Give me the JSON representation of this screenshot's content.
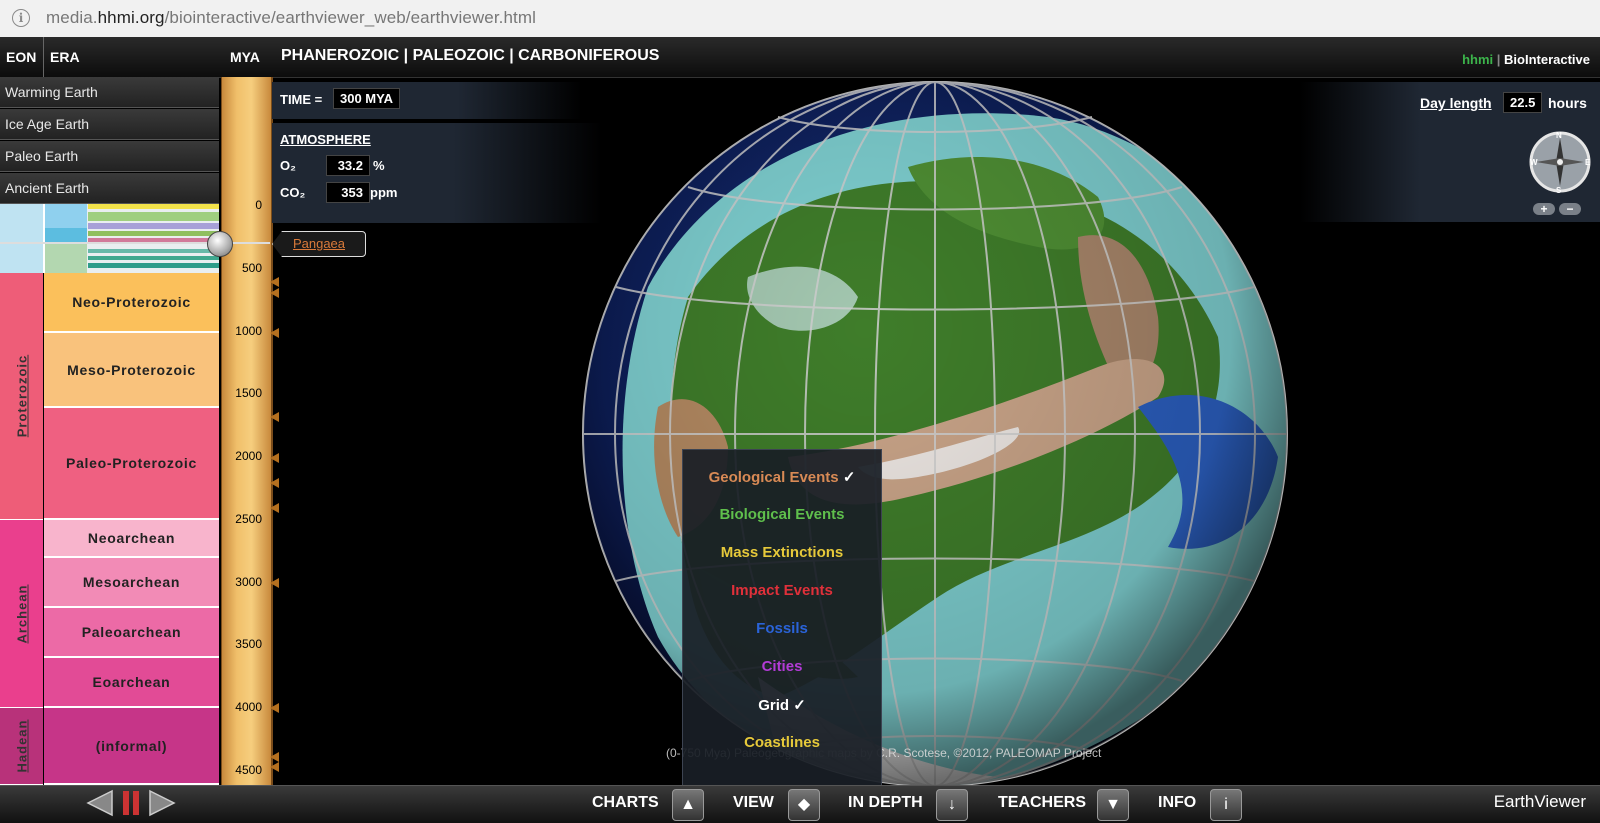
{
  "browser": {
    "url_host_prefix": "media.",
    "url_host": "hhmi.org",
    "url_path": "/biointeractive/earthviewer_web/earthviewer.html"
  },
  "header": {
    "eon_label": "EON",
    "era_label": "ERA",
    "mya_label": "MYA",
    "title": "PHANEROZOIC | PALEOZOIC | CARBONIFEROUS",
    "logo_hhmi": "hhmi",
    "logo_bio": "BioInteractive"
  },
  "menu": [
    "Warming Earth",
    "Ice Age Earth",
    "Paleo Earth",
    "Ancient Earth"
  ],
  "eons": [
    {
      "label": "Proterozoic",
      "color": "#ee5d78"
    },
    {
      "label": "Archean",
      "color": "#ea3f8d"
    },
    {
      "label": "Hadean",
      "color": "#b8327a"
    }
  ],
  "eras": [
    {
      "label": "Neo-Proterozoic",
      "color": "#fbc05b"
    },
    {
      "label": "Meso-Proterozoic",
      "color": "#f9c27c"
    },
    {
      "label": "Paleo-Proterozoic",
      "color": "#ef6081"
    },
    {
      "label": "Neoarchean",
      "color": "#f8b4cc"
    },
    {
      "label": "Mesoarchean",
      "color": "#f28bb6"
    },
    {
      "label": "Paleoarchean",
      "color": "#ec6aa6"
    },
    {
      "label": "Eoarchean",
      "color": "#e24b96"
    },
    {
      "label": "(informal)",
      "color": "#c63588"
    }
  ],
  "ruler_ticks": [
    "0",
    "500",
    "1000",
    "1500",
    "2000",
    "2500",
    "3000",
    "3500",
    "4000",
    "4500"
  ],
  "event_label": "Pangaea",
  "time": {
    "label": "TIME =",
    "value": "300 MYA"
  },
  "atmosphere": {
    "title": "ATMOSPHERE",
    "o2_label": "O₂",
    "o2_value": "33.2",
    "o2_unit": "%",
    "co2_label": "CO₂",
    "co2_value": "353",
    "co2_unit": "ppm"
  },
  "day": {
    "label": "Day length",
    "value": "22.5",
    "unit": "hours"
  },
  "compass": {
    "n": "N",
    "s": "S",
    "e": "E",
    "w": "W",
    "zoom_in": "+",
    "zoom_out": "−"
  },
  "view_menu": [
    {
      "label": "Geological Events",
      "check": "✓",
      "color": "#d88a55"
    },
    {
      "label": "Biological Events",
      "check": "",
      "color": "#5fbf4c"
    },
    {
      "label": "Mass Extinctions",
      "check": "",
      "color": "#e6c93a"
    },
    {
      "label": "Impact Events",
      "check": "",
      "color": "#e0303a"
    },
    {
      "label": "Fossils",
      "check": "",
      "color": "#2a63d8"
    },
    {
      "label": "Cities",
      "check": "",
      "color": "#b23bd6"
    },
    {
      "label": "Grid",
      "check": "✓",
      "color": "#ffffff"
    },
    {
      "label": "Coastlines",
      "check": "",
      "color": "#e6c93a"
    }
  ],
  "credit": "(0-750 Mya) Paleogeographic maps by C.R. Scotese, ©2012, PALEOMAP Project",
  "nav": {
    "charts": "CHARTS",
    "view": "VIEW",
    "in_depth": "IN DEPTH",
    "teachers": "TEACHERS",
    "info": "INFO",
    "brand": "EarthViewer"
  }
}
